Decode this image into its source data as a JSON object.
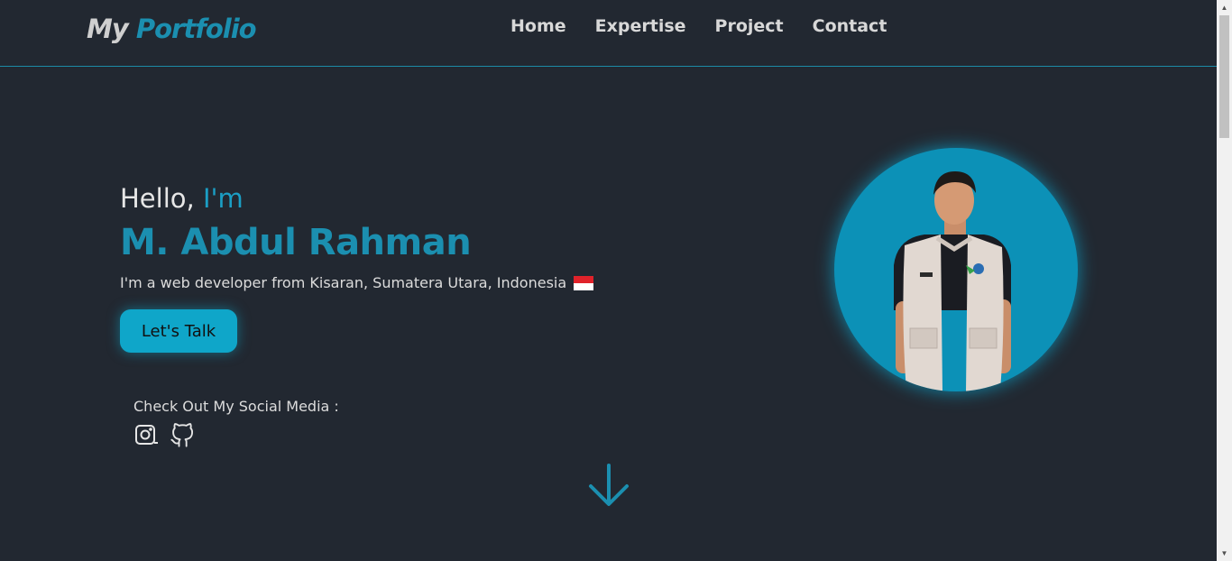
{
  "header": {
    "logo_prefix": "My",
    "logo_accent": "Portfolio",
    "nav": [
      "Home",
      "Expertise",
      "Project",
      "Contact"
    ]
  },
  "hero": {
    "hello": "Hello,",
    "hello_accent": "I'm",
    "name": "M. Abdul Rahman",
    "tagline": "I'm a web developer from Kisaran, Sumatera Utara, Indonesia",
    "cta_label": "Let's Talk",
    "social_label": "Check Out My Social Media :"
  },
  "icons": {
    "flag": "indonesia-flag-icon",
    "social": [
      "instagram-icon",
      "github-icon"
    ],
    "scroll": "arrow-down-icon"
  },
  "colors": {
    "background": "#222831",
    "accent": "#1b8fb0",
    "button": "#0fa6c9",
    "avatar_bg": "#0c91b7"
  }
}
